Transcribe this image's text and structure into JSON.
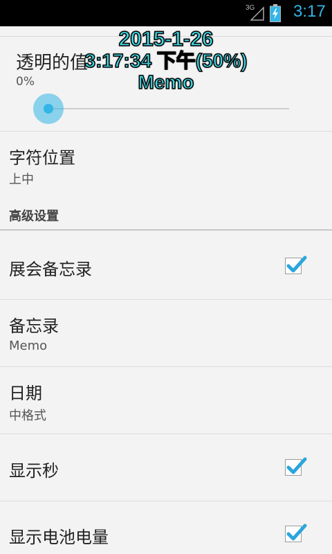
{
  "status_bar": {
    "network": "3G",
    "time": "3:17",
    "accent": "#33b5e5",
    "icons": [
      "signal-icon",
      "battery-charging-icon"
    ]
  },
  "settings": {
    "transparency": {
      "label": "透明的值",
      "value": "0%",
      "slider_fraction": 0.0
    },
    "char_position": {
      "label": "字符位置",
      "value": "上中"
    },
    "advanced_header": "高级设置",
    "show_memo": {
      "label": "展会备忘录",
      "checked": true
    },
    "memo": {
      "label": "备忘录",
      "value": "Memo"
    },
    "date": {
      "label": "日期",
      "value": "中格式"
    },
    "show_seconds": {
      "label": "显示秒",
      "checked": true
    },
    "show_battery": {
      "label": "显示电池电量",
      "checked": true
    }
  },
  "overlay": {
    "line1": "2015-1-26",
    "line2": "3:17:34 下午(50%)",
    "line3": "Memo",
    "color": "#3fd7e3"
  }
}
